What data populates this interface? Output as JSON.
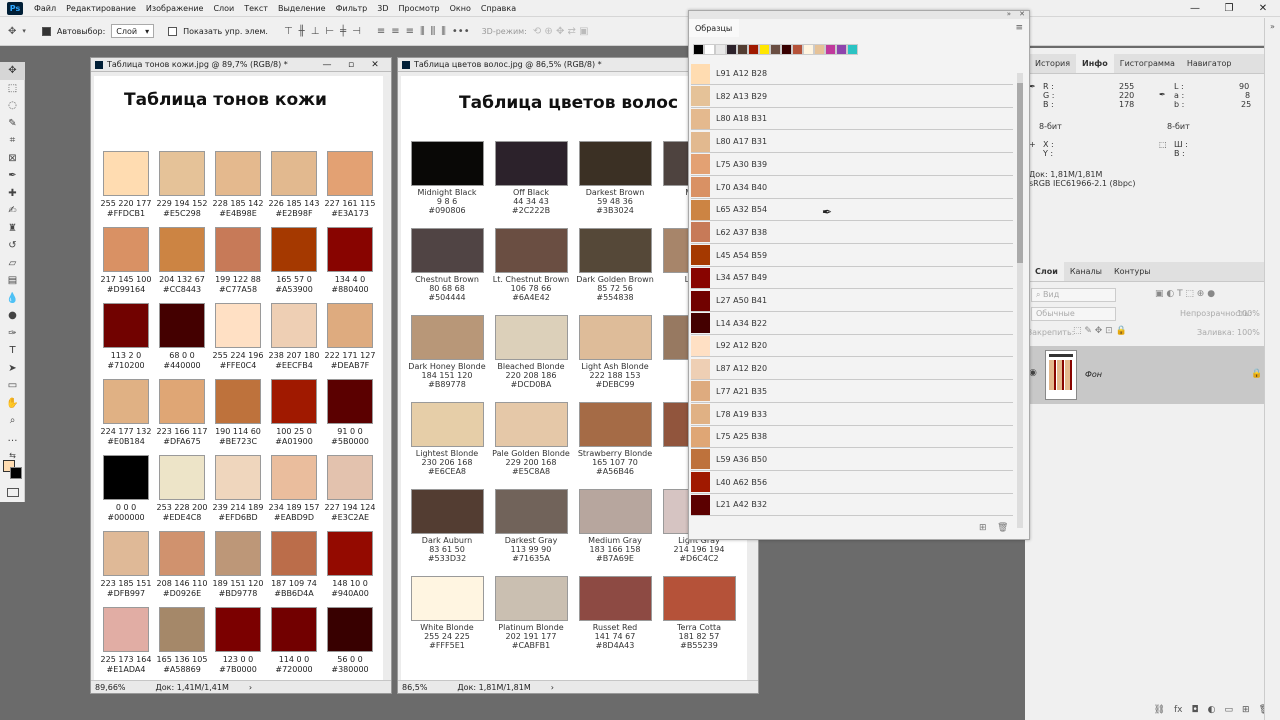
{
  "menu": [
    "Файл",
    "Редактирование",
    "Изображение",
    "Слои",
    "Текст",
    "Выделение",
    "Фильтр",
    "3D",
    "Просмотр",
    "Окно",
    "Справка"
  ],
  "options": {
    "autoselect": "Автовыбор:",
    "layer": "Слой",
    "show_controls": "Показать упр. элем.",
    "mode3d": "3D-режим:"
  },
  "skin_doc": {
    "title": "Таблица тонов кожи.jpg @ 89,7% (RGB/8) *",
    "heading": "Таблица тонов кожи",
    "zoom": "89,66%",
    "doc": "Док: 1,41M/1,41M",
    "swatches": [
      {
        "rgb": "255 220 177",
        "hex": "#FFDCB1"
      },
      {
        "rgb": "229 194 152",
        "hex": "#E5C298"
      },
      {
        "rgb": "228 185 142",
        "hex": "#E4B98E"
      },
      {
        "rgb": "226 185 143",
        "hex": "#E2B98F"
      },
      {
        "rgb": "227 161 115",
        "hex": "#E3A173"
      },
      {
        "rgb": "217 145 100",
        "hex": "#D99164"
      },
      {
        "rgb": "204 132 67",
        "hex": "#CC8443"
      },
      {
        "rgb": "199 122 88",
        "hex": "#C77A58"
      },
      {
        "rgb": "165 57 0",
        "hex": "#A53900"
      },
      {
        "rgb": "134 4 0",
        "hex": "#880400"
      },
      {
        "rgb": "113 2 0",
        "hex": "#710200"
      },
      {
        "rgb": "68 0 0",
        "hex": "#440000"
      },
      {
        "rgb": "255 224 196",
        "hex": "#FFE0C4"
      },
      {
        "rgb": "238 207 180",
        "hex": "#EECFB4"
      },
      {
        "rgb": "222 171 127",
        "hex": "#DEAB7F"
      },
      {
        "rgb": "224 177 132",
        "hex": "#E0B184"
      },
      {
        "rgb": "223 166 117",
        "hex": "#DFA675"
      },
      {
        "rgb": "190 114 60",
        "hex": "#BE723C"
      },
      {
        "rgb": "100 25 0",
        "hex": "#A01900"
      },
      {
        "rgb": "91 0 0",
        "hex": "#5B0000"
      },
      {
        "rgb": "0 0 0",
        "hex": "#000000"
      },
      {
        "rgb": "253 228 200",
        "hex": "#EDE4C8"
      },
      {
        "rgb": "239 214 189",
        "hex": "#EFD6BD"
      },
      {
        "rgb": "234 189 157",
        "hex": "#EABD9D"
      },
      {
        "rgb": "227 194 124",
        "hex": "#E3C2AE"
      },
      {
        "rgb": "223 185 151",
        "hex": "#DFB997"
      },
      {
        "rgb": "208 146 110",
        "hex": "#D0926E"
      },
      {
        "rgb": "189 151 120",
        "hex": "#BD9778"
      },
      {
        "rgb": "187 109 74",
        "hex": "#BB6D4A"
      },
      {
        "rgb": "148 10 0",
        "hex": "#940A00"
      },
      {
        "rgb": "225 173 164",
        "hex": "#E1ADA4"
      },
      {
        "rgb": "165 136 105",
        "hex": "#A58869"
      },
      {
        "rgb": "123 0 0",
        "hex": "#7B0000"
      },
      {
        "rgb": "114 0 0",
        "hex": "#720000"
      },
      {
        "rgb": "56 0 0",
        "hex": "#380000"
      }
    ]
  },
  "hair_doc": {
    "title": "Таблица цветов волос.jpg @ 86,5% (RGB/8) *",
    "heading": "Таблица цветов волос",
    "zoom": "86,5%",
    "doc": "Док: 1,81M/1,81M",
    "swatches": [
      {
        "name": "Midnight Black",
        "rgb": "9 8 6",
        "hex": "#090806"
      },
      {
        "name": "Off Black",
        "rgb": "44 34 43",
        "hex": "#2C222B"
      },
      {
        "name": "Darkest Brown",
        "rgb": "59 48 36",
        "hex": "#3B3024"
      },
      {
        "name": "Med. B",
        "rgb": "78",
        "hex": "#"
      },
      {
        "name": "Chestnut Brown",
        "rgb": "80 68 68",
        "hex": "#504444"
      },
      {
        "name": "Lt. Chestnut Brown",
        "rgb": "106 78 66",
        "hex": "#6A4E42"
      },
      {
        "name": "Dark Golden Brown",
        "rgb": "85 72 56",
        "hex": "#554838"
      },
      {
        "name": "Light G",
        "rgb": "167",
        "hex": "#A"
      },
      {
        "name": "Dark Honey Blonde",
        "rgb": "184 151 120",
        "hex": "#B89778"
      },
      {
        "name": "Bleached Blonde",
        "rgb": "220 208 186",
        "hex": "#DCD0BA"
      },
      {
        "name": "Light Ash Blonde",
        "rgb": "222 188 153",
        "hex": "#DEBC99"
      },
      {
        "name": "Light",
        "rgb": "1",
        "hex": "#"
      },
      {
        "name": "Lightest Blonde",
        "rgb": "230 206 168",
        "hex": "#E6CEA8"
      },
      {
        "name": "Pale Golden Blonde",
        "rgb": "229 200 168",
        "hex": "#E5C8A8"
      },
      {
        "name": "Strawberry Blonde",
        "rgb": "165 107 70",
        "hex": "#A56B46"
      },
      {
        "name": "Ligh",
        "rgb": "14",
        "hex": "#"
      },
      {
        "name": "Dark Auburn",
        "rgb": "83 61 50",
        "hex": "#533D32"
      },
      {
        "name": "Darkest Gray",
        "rgb": "113 99 90",
        "hex": "#71635A"
      },
      {
        "name": "Medium Gray",
        "rgb": "183 166 158",
        "hex": "#B7A69E"
      },
      {
        "name": "Light Gray",
        "rgb": "214 196 194",
        "hex": "#D6C4C2"
      },
      {
        "name": "White Blonde",
        "rgb": "255 24 225",
        "hex": "#FFF5E1"
      },
      {
        "name": "Platinum Blonde",
        "rgb": "202 191 177",
        "hex": "#CABFB1"
      },
      {
        "name": "Russet Red",
        "rgb": "141 74 67",
        "hex": "#8D4A43"
      },
      {
        "name": "Terra Cotta",
        "rgb": "181 82 57",
        "hex": "#B55239"
      }
    ]
  },
  "swatches_panel": {
    "tab": "Образцы",
    "recent": [
      "#000000",
      "#ffffff",
      "#e8e8e8",
      "#2c222b",
      "#533d32",
      "#a01900",
      "#ffe600",
      "#6a4e42",
      "#380000",
      "#b55239",
      "#fff5e1",
      "#e5c298",
      "#c0399c",
      "#8e44ad",
      "#2bc3c3"
    ],
    "items": [
      {
        "name": "L91 A12 B28",
        "color": "#FFDCB1"
      },
      {
        "name": "L82 A13 B29",
        "color": "#E5C298"
      },
      {
        "name": "L80 A18 B31",
        "color": "#E4B98E"
      },
      {
        "name": "L80 A17 B31",
        "color": "#E2B98F"
      },
      {
        "name": "L75 A30 B39",
        "color": "#E3A173"
      },
      {
        "name": "L70 A34 B40",
        "color": "#D99164"
      },
      {
        "name": "L65 A32 B54",
        "color": "#CC8443"
      },
      {
        "name": "L62 A37 B38",
        "color": "#C77A58"
      },
      {
        "name": "L45 A54 B59",
        "color": "#A53900"
      },
      {
        "name": "L34 A57 B49",
        "color": "#880400"
      },
      {
        "name": "L27 A50 B41",
        "color": "#710200"
      },
      {
        "name": "L14 A34 B22",
        "color": "#440000"
      },
      {
        "name": "L92 A12 B20",
        "color": "#FFE0C4"
      },
      {
        "name": "L87 A12 B20",
        "color": "#EECFB4"
      },
      {
        "name": "L77 A21 B35",
        "color": "#DEAB7F"
      },
      {
        "name": "L78 A19 B33",
        "color": "#E0B184"
      },
      {
        "name": "L75 A25 B38",
        "color": "#DFA675"
      },
      {
        "name": "L59 A36 B50",
        "color": "#BE723C"
      },
      {
        "name": "L40 A62 B56",
        "color": "#A01900"
      },
      {
        "name": "L21 A42 B32",
        "color": "#5B0000"
      }
    ]
  },
  "info_panel": {
    "tabs": [
      "История",
      "Инфо",
      "Гистограмма",
      "Навигатор"
    ],
    "r_label": "R :",
    "g_label": "G :",
    "b_label": "B :",
    "r": "255",
    "g": "220",
    "b": "178",
    "l_label": "L :",
    "a_label": "a :",
    "bb_label": "b :",
    "l": "90",
    "a": "8",
    "bb": "25",
    "bit1": "8-бит",
    "bit2": "8-бит",
    "x": "X :",
    "y": "Y :",
    "w": "Ш :",
    "h": "В :",
    "doc": "Док: 1,81M/1,81M",
    "profile": "sRGB IEC61966-2.1 (8bpc)"
  },
  "layers_panel": {
    "tabs": [
      "Слои",
      "Каналы",
      "Контуры"
    ],
    "kind": "Вид",
    "blend": "Обычные",
    "opacity_label": "Непрозрачность:",
    "opacity": "100%",
    "lock_label": "Закрепить:",
    "fill_label": "Заливка:",
    "fill": "100%",
    "layer_name": "Фон"
  }
}
